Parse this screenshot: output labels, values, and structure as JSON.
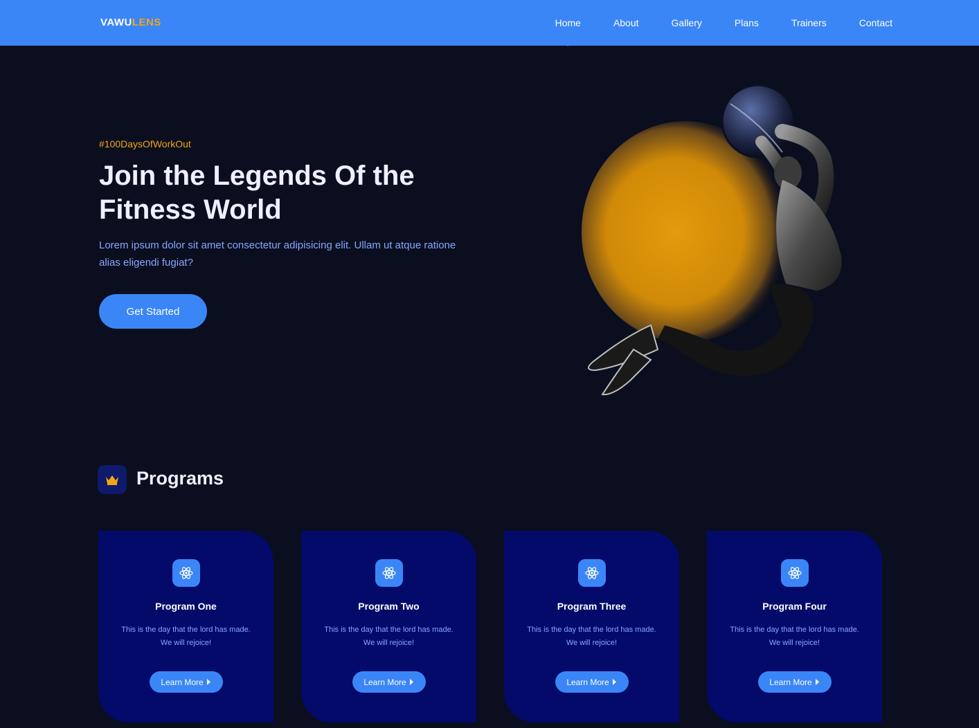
{
  "brand": {
    "part1": "VAWU",
    "part2": "LENS"
  },
  "nav": {
    "items": [
      "Home",
      "About",
      "Gallery",
      "Plans",
      "Trainers",
      "Contact"
    ],
    "active": "Home"
  },
  "hero": {
    "tag": "#100DaysOfWorkOut",
    "title_line1": "Join the Legends Of the",
    "title_line2": "Fitness World",
    "description": "Lorem ipsum dolor sit amet consectetur adipisicing elit. Ullam ut atque ratione alias eligendi fugiat?",
    "cta": "Get Started"
  },
  "programs": {
    "heading": "Programs",
    "icon": "crown-icon",
    "cards": [
      {
        "title": "Program One",
        "desc1": "This is the day that the lord has made.",
        "desc2": "We will rejoice!",
        "button": "Learn More"
      },
      {
        "title": "Program Two",
        "desc1": "This is the day that the lord has made.",
        "desc2": "We will rejoice!",
        "button": "Learn More"
      },
      {
        "title": "Program Three",
        "desc1": "This is the day that the lord has made.",
        "desc2": "We will rejoice!",
        "button": "Learn More"
      },
      {
        "title": "Program Four",
        "desc1": "This is the day that the lord has made.",
        "desc2": "We will rejoice!",
        "button": "Learn More"
      }
    ]
  },
  "colors": {
    "accent": "#3a86f7",
    "brand_orange": "#f2a516",
    "background": "#0a0e1e",
    "card": "#030a6a",
    "text_soft": "#8aa6ff"
  }
}
